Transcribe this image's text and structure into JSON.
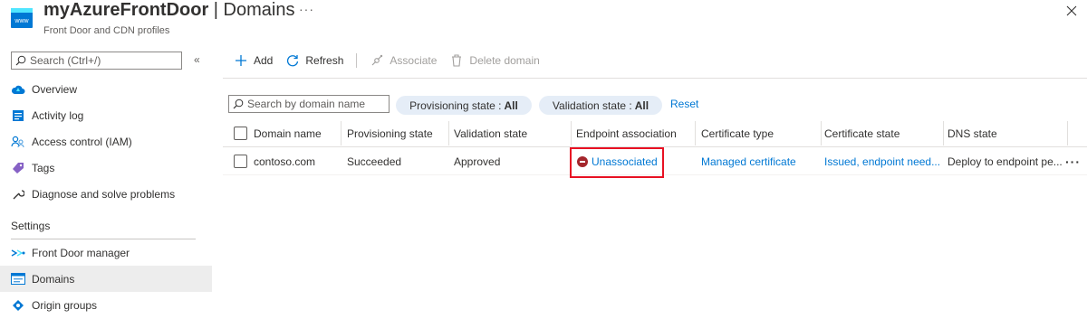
{
  "header": {
    "title_bold": "myAzureFrontDoor",
    "title_rest": " | Domains",
    "more": "···",
    "subtitle": "Front Door and CDN profiles",
    "icon_text": "www"
  },
  "sidebar": {
    "search_placeholder": "Search (Ctrl+/)",
    "collapse": "«",
    "items": [
      {
        "label": "Overview",
        "icon": "cloud-icon"
      },
      {
        "label": "Activity log",
        "icon": "activity-log-icon"
      },
      {
        "label": "Access control (IAM)",
        "icon": "people-icon"
      },
      {
        "label": "Tags",
        "icon": "tag-icon"
      },
      {
        "label": "Diagnose and solve problems",
        "icon": "wrench-icon"
      }
    ],
    "section_label": "Settings",
    "settings_items": [
      {
        "label": "Front Door manager",
        "icon": "front-door-manager-icon"
      },
      {
        "label": "Domains",
        "icon": "domains-icon",
        "active": true
      },
      {
        "label": "Origin groups",
        "icon": "origin-groups-icon"
      }
    ]
  },
  "toolbar": {
    "add": "Add",
    "refresh": "Refresh",
    "associate": "Associate",
    "delete": "Delete domain"
  },
  "filters": {
    "search_placeholder": "Search by domain name",
    "prov_label": "Provisioning state :",
    "prov_value": "All",
    "valid_label": "Validation state :",
    "valid_value": "All",
    "reset": "Reset"
  },
  "table": {
    "columns": [
      "Domain name",
      "Provisioning state",
      "Validation state",
      "Endpoint association",
      "Certificate type",
      "Certificate state",
      "DNS state"
    ],
    "rows": [
      {
        "domain": "contoso.com",
        "provisioning": "Succeeded",
        "validation": "Approved",
        "endpoint": "Unassociated",
        "cert_type": "Managed certificate",
        "cert_state": "Issued, endpoint need...",
        "dns_state": "Deploy to endpoint pe..."
      }
    ],
    "row_more": "···"
  },
  "colors": {
    "accent": "#0078d4",
    "highlight": "#e81123",
    "error": "#a4262c"
  }
}
